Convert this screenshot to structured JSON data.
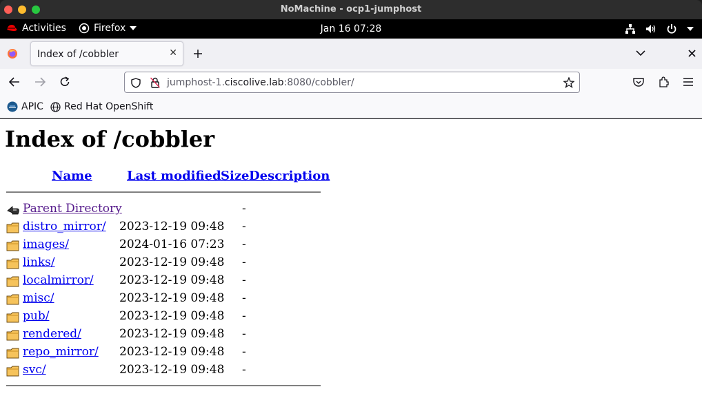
{
  "window": {
    "title": "NoMachine - ocp1-jumphost",
    "traffic_colors": [
      "#ff5f57",
      "#febc2e",
      "#28c840"
    ]
  },
  "gnome": {
    "activities": "Activities",
    "app": "Firefox",
    "clock": "Jan 16  07:28"
  },
  "browser": {
    "tab_title": "Index of /cobbler",
    "url_host_prefix": "jumphost-1.",
    "url_host_domain": "ciscolive.lab",
    "url_rest": ":8080/cobbler/",
    "bookmarks": [
      "APIC",
      "Red Hat OpenShift"
    ]
  },
  "listing": {
    "heading": "Index of /cobbler",
    "columns": {
      "name": "Name",
      "modified": "Last modified",
      "size": "Size",
      "description": "Description"
    },
    "parent": {
      "name": "Parent Directory",
      "size": "-"
    },
    "rows": [
      {
        "name": "distro_mirror/",
        "modified": "2023-12-19 09:48",
        "size": "-"
      },
      {
        "name": "images/",
        "modified": "2024-01-16 07:23",
        "size": "-"
      },
      {
        "name": "links/",
        "modified": "2023-12-19 09:48",
        "size": "-"
      },
      {
        "name": "localmirror/",
        "modified": "2023-12-19 09:48",
        "size": "-"
      },
      {
        "name": "misc/",
        "modified": "2023-12-19 09:48",
        "size": "-"
      },
      {
        "name": "pub/",
        "modified": "2023-12-19 09:48",
        "size": "-"
      },
      {
        "name": "rendered/",
        "modified": "2023-12-19 09:48",
        "size": "-"
      },
      {
        "name": "repo_mirror/",
        "modified": "2023-12-19 09:48",
        "size": "-"
      },
      {
        "name": "svc/",
        "modified": "2023-12-19 09:48",
        "size": "-"
      }
    ]
  }
}
